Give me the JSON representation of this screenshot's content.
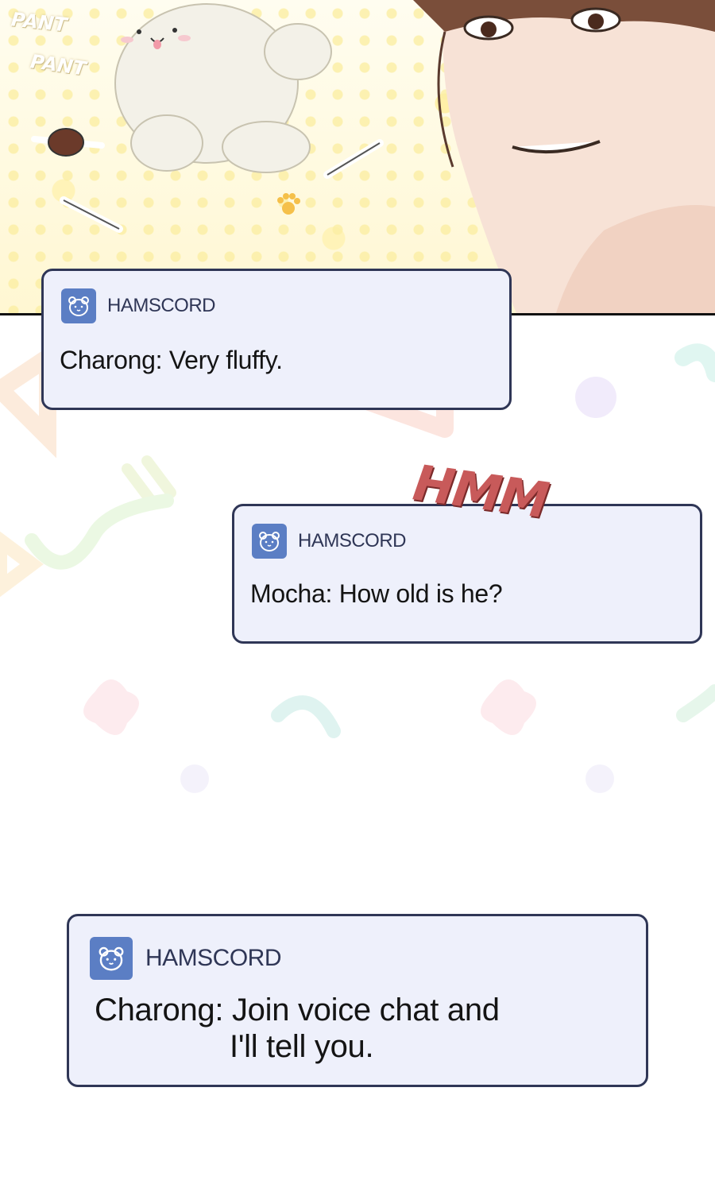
{
  "panel": {
    "sfx_pant_1": "PANT",
    "sfx_pant_2": "PANT"
  },
  "sfx_hmm": "HMM",
  "notifications": [
    {
      "app_name": "HAMSCORD",
      "message": "Charong: Very fluffy."
    },
    {
      "app_name": "HAMSCORD",
      "message": "Mocha: How old is he?"
    },
    {
      "app_name": "HAMSCORD",
      "message_line1": "Charong: Join voice chat and",
      "message_line2": "I'll tell you."
    }
  ],
  "colors": {
    "card_bg": "#eef0fb",
    "card_border": "#2f3656",
    "icon_bg": "#5b7ec4",
    "sfx_hmm": "#c85a5a"
  },
  "icons": [
    "hamster-icon"
  ]
}
